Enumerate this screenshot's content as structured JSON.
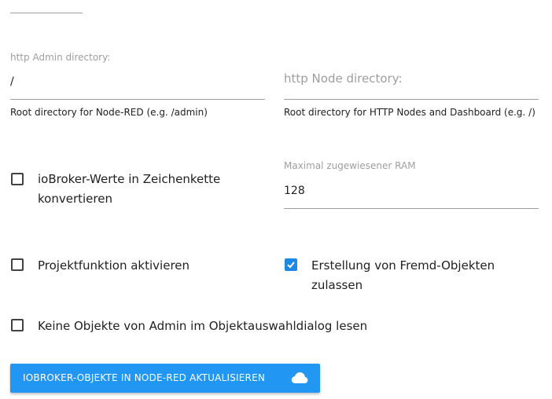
{
  "admin_dir": {
    "label": "http Admin directory:",
    "value": "/",
    "helper": "Root directory for Node-RED (e.g. /admin)"
  },
  "node_dir": {
    "label": "http Node directory:",
    "value": "",
    "helper": "Root directory for HTTP Nodes and Dashboard (e.g. /)"
  },
  "ram": {
    "label": "Maximal zugewiesener RAM",
    "value": "128"
  },
  "checkboxes": {
    "convert_strings": {
      "label": "ioBroker-Werte in Zeichenkette konvertieren",
      "checked": false
    },
    "project_mode": {
      "label": "Projektfunktion aktivieren",
      "checked": false
    },
    "foreign_objects": {
      "label": "Erstellung von Fremd-Objekten zulassen",
      "checked": true
    },
    "no_admin_objects": {
      "label": "Keine Objekte von Admin im Objektauswahldialog lesen",
      "checked": false
    }
  },
  "update_button": {
    "label": "IOBROKER-OBJEKTE IN NODE-RED AKTUALISIEREN",
    "icon": "cloud-icon"
  },
  "colors": {
    "accent": "#2196f3",
    "checkbox_checked": "#1e88e5",
    "muted_text": "#9e9e9e"
  }
}
